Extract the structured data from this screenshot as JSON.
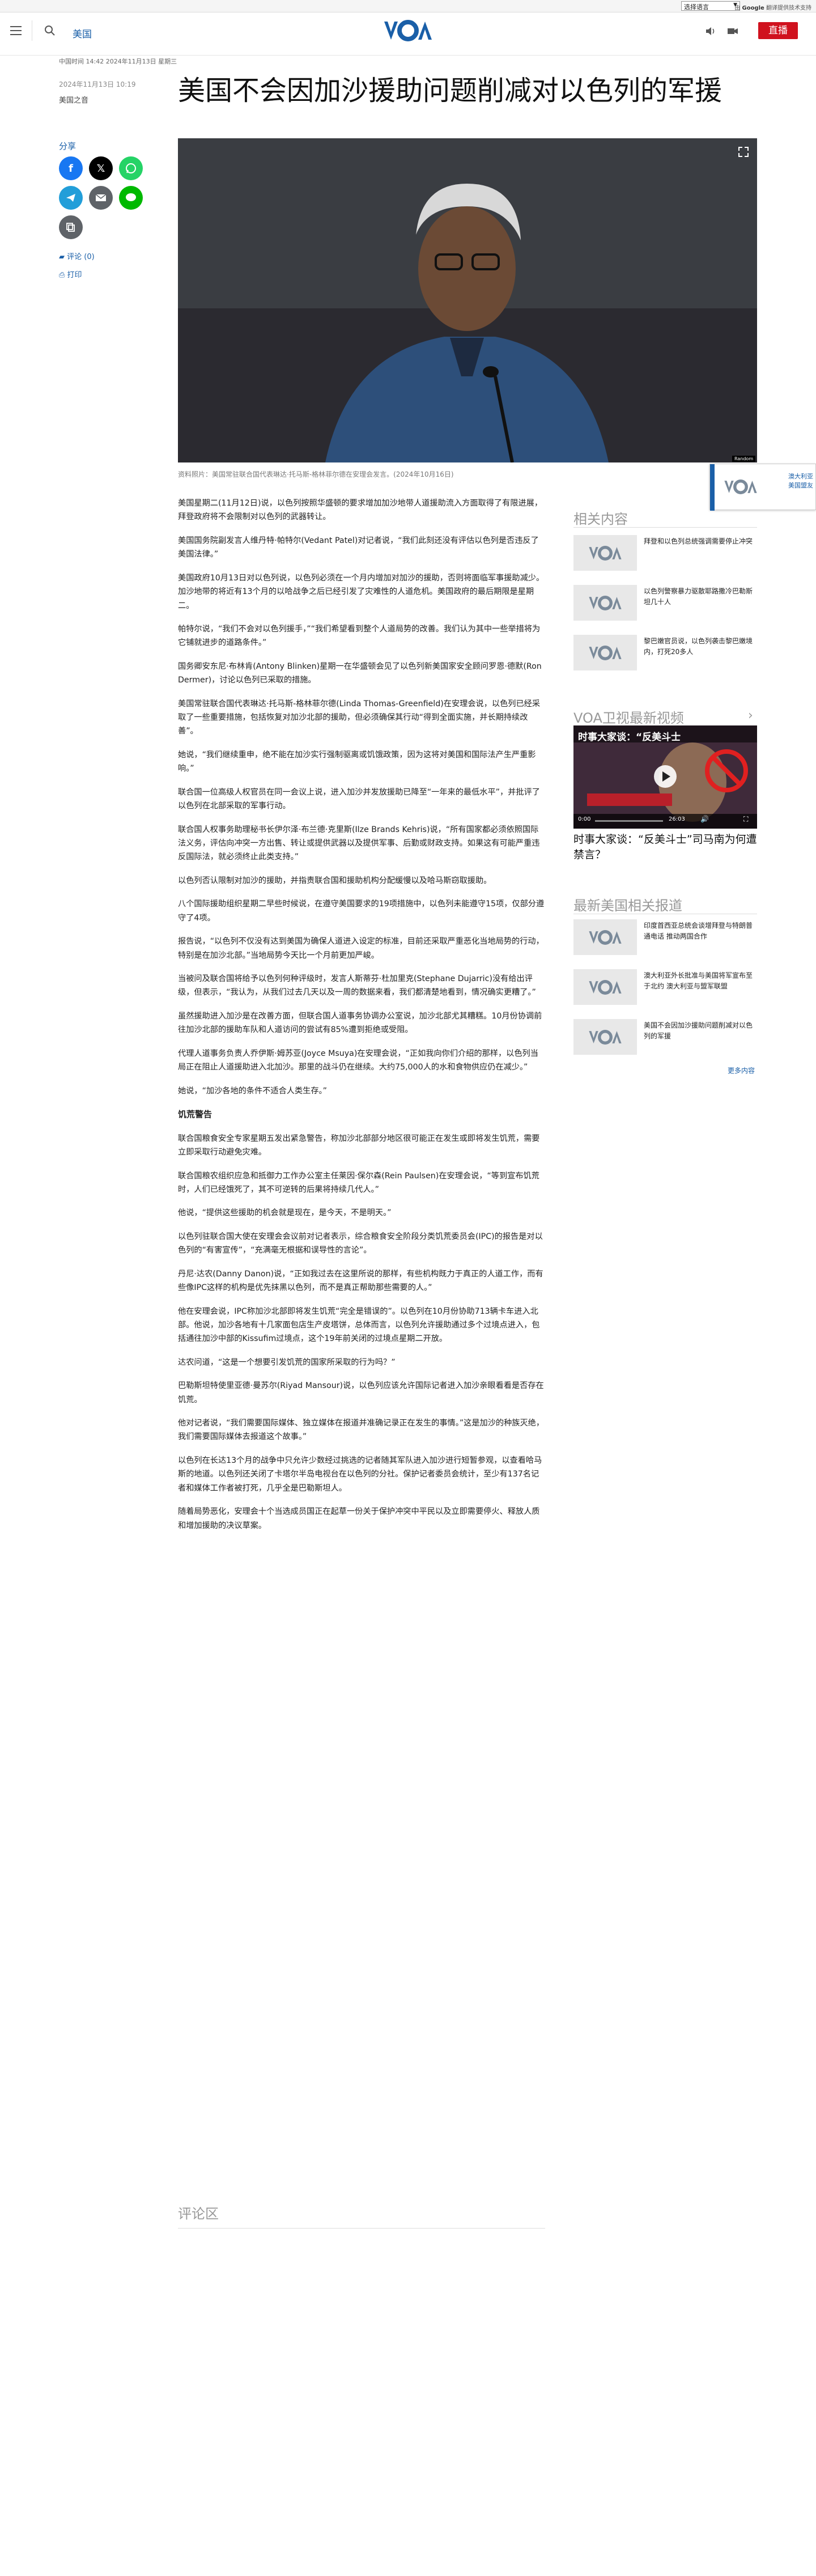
{
  "topbar": {
    "language_selector": "选择语言",
    "powered_by_prefix": "由",
    "powered_by_brand": "Google",
    "powered_by_suffix": "翻译提供技术支持"
  },
  "header": {
    "section": "美国",
    "live_label": "直播"
  },
  "timestamp_strip": "中国时间 14:42 2024年11月13日 星期三",
  "article": {
    "date": "2024年11月13日 10:19",
    "source": "美国之音",
    "title": "美国不会因加沙援助问题削减对以色列的军援",
    "caption": "资料照片：美国常驻联合国代表琳达·托马斯-格林菲尔德在安理会发言。(2024年10月16日)",
    "paragraphs": [
      "美国星期二(11月12日)说，以色列按照华盛顿的要求增加加沙地带人道援助流入方面取得了有限进展，拜登政府将不会限制对以色列的武器转让。",
      "美国国务院副发言人维丹特·帕特尔(Vedant Patel)对记者说，“我们此刻还没有评估以色列是否违反了美国法律。”",
      "美国政府10月13日对以色列说，以色列必须在一个月内增加对加沙的援助，否则将面临军事援助减少。加沙地带的将近有13个月的以哈战争之后已经引发了灾难性的人道危机。美国政府的最后期限是星期二。",
      "帕特尔说，“我们不会对以色列援手，”“我们希望看到整个人道局势的改善。我们认为其中一些举措将为它铺就进步的道路条件。”",
      "国务卿安东尼·布林肯(Antony Blinken)星期一在华盛顿会见了以色列新美国家安全顾问罗恩·德默(Ron Dermer)，讨论以色列已采取的措施。",
      "美国常驻联合国代表琳达·托马斯-格林菲尔德(Linda Thomas-Greenfield)在安理会说，以色列已经采取了一些重要措施，包括恢复对加沙北部的援助，但必须确保其行动“得到全面实施，并长期持续改善”。",
      "她说，“我们继续重申，绝不能在加沙实行强制驱离或饥饿政策，因为这将对美国和国际法产生严重影响。”",
      "联合国一位高级人权官员在同一会议上说，进入加沙并发放援助已降至“一年来的最低水平”，并批评了以色列在北部采取的军事行动。",
      "联合国人权事务助理秘书长伊尔泽·布兰德·克里斯(Ilze Brands Kehris)说，“所有国家都必须依照国际法义务，评估向冲突一方出售、转让或提供武器以及提供军事、后勤或财政支持。如果这有可能严重违反国际法，就必须终止此类支持。”",
      "以色列否认限制对加沙的援助，并指责联合国和援助机构分配缓慢以及哈马斯窃取援助。",
      "八个国际援助组织星期二早些时候说，在遵守美国要求的19项措施中，以色列未能遵守15项，仅部分遵守了4项。",
      "报告说，“以色列不仅没有达到美国为确保人道进入设定的标准，目前还采取严重恶化当地局势的行动，特别是在加沙北部。”当地局势今天比一个月前更加严峻。",
      "当被问及联合国将给予以色列何种评级时，发言人斯蒂芬·杜加里克(Stephane Dujarric)没有给出评级，但表示，“我认为，从我们过去几天以及一周的数据来看，我们都清楚地看到，情况确实更糟了。”",
      "虽然援助进入加沙是在改善方面，但联合国人道事务协调办公室说，加沙北部尤其糟糕。10月份协调前往加沙北部的援助车队和人道访问的尝试有85%遭到拒绝或受阻。",
      "代理人道事务负责人乔伊斯·姆苏亚(Joyce Msuya)在安理会说，“正如我向你们介绍的那样，以色列当局正在阻止人道援助进入北加沙。那里的战斗仍在继续。大约75,000人的水和食物供应仍在减少。”",
      "她说，“加沙各地的条件不适合人类生存。”"
    ],
    "subheading": "饥荒警告",
    "paragraphs2": [
      "联合国粮食安全专家星期五发出紧急警告，称加沙北部部分地区很可能正在发生或即将发生饥荒，需要立即采取行动避免灾难。",
      "联合国粮农组织应急和抵御力工作办公室主任莱因·保尔森(Rein Paulsen)在安理会说，“等到宣布饥荒时，人们已经饿死了，其不可逆转的后果将持续几代人。”",
      "他说，“提供这些援助的机会就是现在，是今天，不是明天。”",
      "以色列驻联合国大使在安理会会议前对记者表示，综合粮食安全阶段分类饥荒委员会(IPC)的报告是对以色列的“有害宣传”，“充满毫无根据和误导性的言论”。",
      "丹尼·达农(Danny Danon)说，“正如我过去在这里所说的那样，有些机构既力于真正的人道工作，而有些像IPC这样的机构是优先抹黑以色列，而不是真正帮助那些需要的人。”",
      "他在安理会说，IPC称加沙北部即将发生饥荒“完全是错误的”。以色列在10月份协助713辆卡车进入北部。他说，加沙各地有十几家面包店生产皮塔饼，总体而言，以色列允许援助通过多个过境点进入，包括通往加沙中部的Kissufim过境点，这个19年前关闭的过境点星期二开放。",
      "达农问道，“这是一个想要引发饥荒的国家所采取的行为吗？”",
      "巴勒斯坦特使里亚德·曼苏尔(Riyad Mansour)说，以色列应该允许国际记者进入加沙亲眼看看是否存在饥荒。",
      "他对记者说，“我们需要国际媒体、独立媒体在报道并准确记录正在发生的事情。”这是加沙的种族灭绝，我们需要国际媒体去报道这个故事。”",
      "以色列在长达13个月的战争中只允许少数经过挑选的记者随其军队进入加沙进行短暂参观，以查看哈马斯的地道。以色列还关闭了卡塔尔半岛电视台在以色列的分社。保护记者委员会统计，至少有137名记者和媒体工作者被打死，几乎全是巴勒斯坦人。",
      "随着局势恶化，安理会十个当选成员国正在起草一份关于保护冲突中平民以及立即需要停火、释放人质和增加援助的决议草案。"
    ],
    "comments_heading": "评论区"
  },
  "share": {
    "label": "分享",
    "comments": "评论 (0)",
    "print": "打印"
  },
  "sidebar": {
    "related_title": "相关内容",
    "related": [
      "拜登和以色列总统强调需要停止冲突",
      "以色列警察暴力驱散耶路撒冷巴勒斯坦几十人",
      "黎巴嫩官员说，以色列袭击黎巴嫩境内，打死20多人"
    ],
    "video_title": "VOA卫视最新视频",
    "video_caption": "时事大家谈：“反美斗士”司马南为何遭禁言？",
    "video_banner": "时事大家谈：“反美斗士",
    "video_current": "0:00",
    "video_total": "26:03",
    "latest_title": "最新美国相关报道",
    "latest": [
      "印度首西亚总统会谈增拜登与特朗普通电话 推动两国合作",
      "澳大利亚外长批准与美国将军宣布至于北约 澳大利亚与盟军联盟",
      "美国不会因加沙援助问题削减对以色列的军援"
    ],
    "more": "更多内容"
  },
  "floating": {
    "tag": "Random",
    "text": "澳大利亚美国盟友"
  },
  "colors": {
    "accent": "#1a5fa8",
    "live": "#d0121e",
    "voa": "#1a5fa8"
  }
}
